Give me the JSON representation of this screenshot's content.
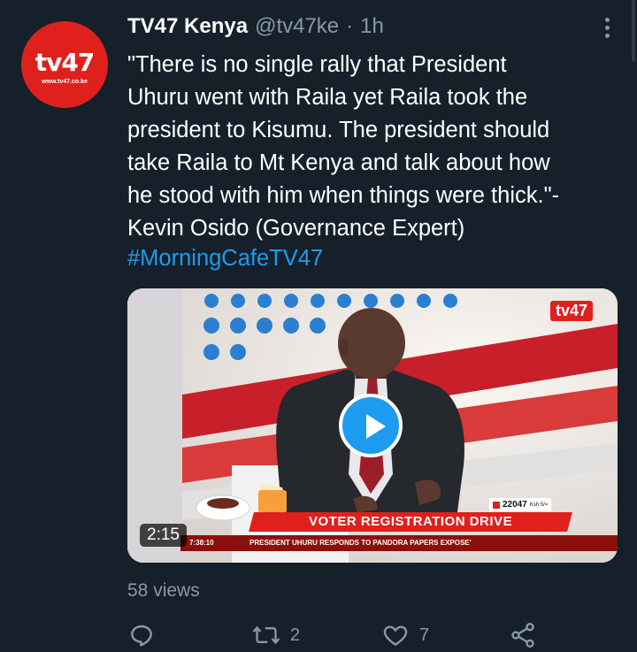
{
  "account": {
    "avatar_logo": "tv47",
    "avatar_url": "www.tv47.co.ke",
    "name": "TV47 Kenya",
    "handle": "@tv47ke",
    "separator": "·",
    "time": "1h"
  },
  "tweet": {
    "text": "\"There is no single rally that President\nUhuru went with Raila yet Raila took the\npresident to Kisumu. The president should\ntake Raila to Mt Kenya and talk about how\nhe stood with him when things were thick.\"-\nKevin Osido (Governance Expert)",
    "hashtag": "#MorningCafeTV47"
  },
  "video": {
    "channel_logo": "tv47",
    "duration": "2:15",
    "counter_value": "22047",
    "counter_unit": "Ksh 5/=",
    "lower_third_title": "VOTER REGISTRATION DRIVE",
    "ticker_clock": "7:38:10",
    "ticker_text": "PRESIDENT UHURU RESPONDS TO PANDORA PAPERS EXPOSE'"
  },
  "stats": {
    "views": "58 views"
  },
  "actions": {
    "reply_count": "",
    "retweet_count": "2",
    "like_count": "7"
  },
  "colors": {
    "background": "#15202b",
    "accent": "#1d9bf0",
    "muted": "#8b98a5",
    "brand_red": "#e0201c"
  }
}
